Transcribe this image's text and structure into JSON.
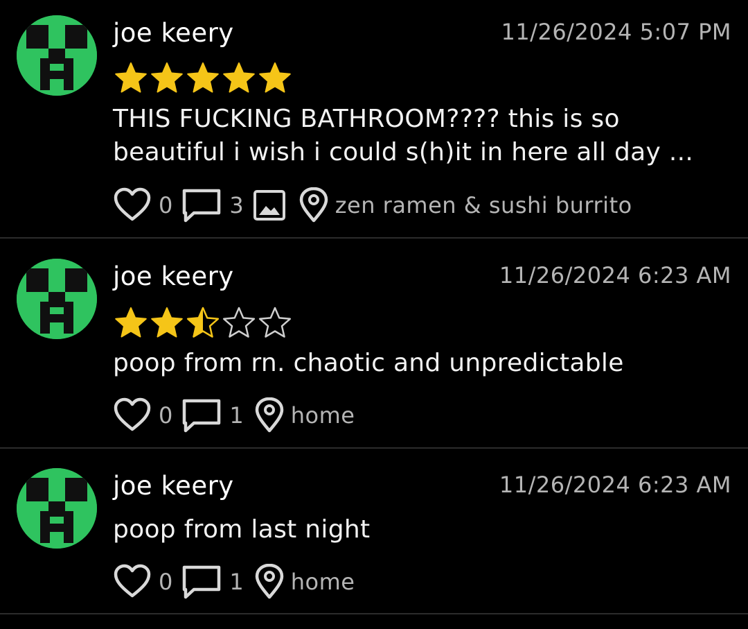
{
  "posts": [
    {
      "username": "joe keery",
      "timestamp": "11/26/2024 5:07 PM",
      "rating": 5,
      "text": "THIS FUCKING BATHROOM???? this is so beautiful i wish i could s(h)it in here all day ...",
      "likes": "0",
      "comments": "3",
      "has_photo": true,
      "location": "zen ramen & sushi burrito"
    },
    {
      "username": "joe keery",
      "timestamp": "11/26/2024 6:23 AM",
      "rating": 2.5,
      "text": "poop from rn. chaotic and unpredictable",
      "likes": "0",
      "comments": "1",
      "has_photo": false,
      "location": "home"
    },
    {
      "username": "joe keery",
      "timestamp": "11/26/2024 6:23 AM",
      "rating": null,
      "text": "poop from last night",
      "likes": "0",
      "comments": "1",
      "has_photo": false,
      "location": "home"
    }
  ],
  "icons": {
    "like": "heart-outline-icon",
    "comment": "speech-bubble-icon",
    "photo": "image-icon",
    "location": "map-pin-icon",
    "avatar": "creeper-face-avatar"
  },
  "colors": {
    "background": "#000000",
    "star": "#f5c518",
    "muted_text": "#b5b5b5",
    "divider": "#2c2c2c",
    "avatar_green": "#2fc35f"
  }
}
